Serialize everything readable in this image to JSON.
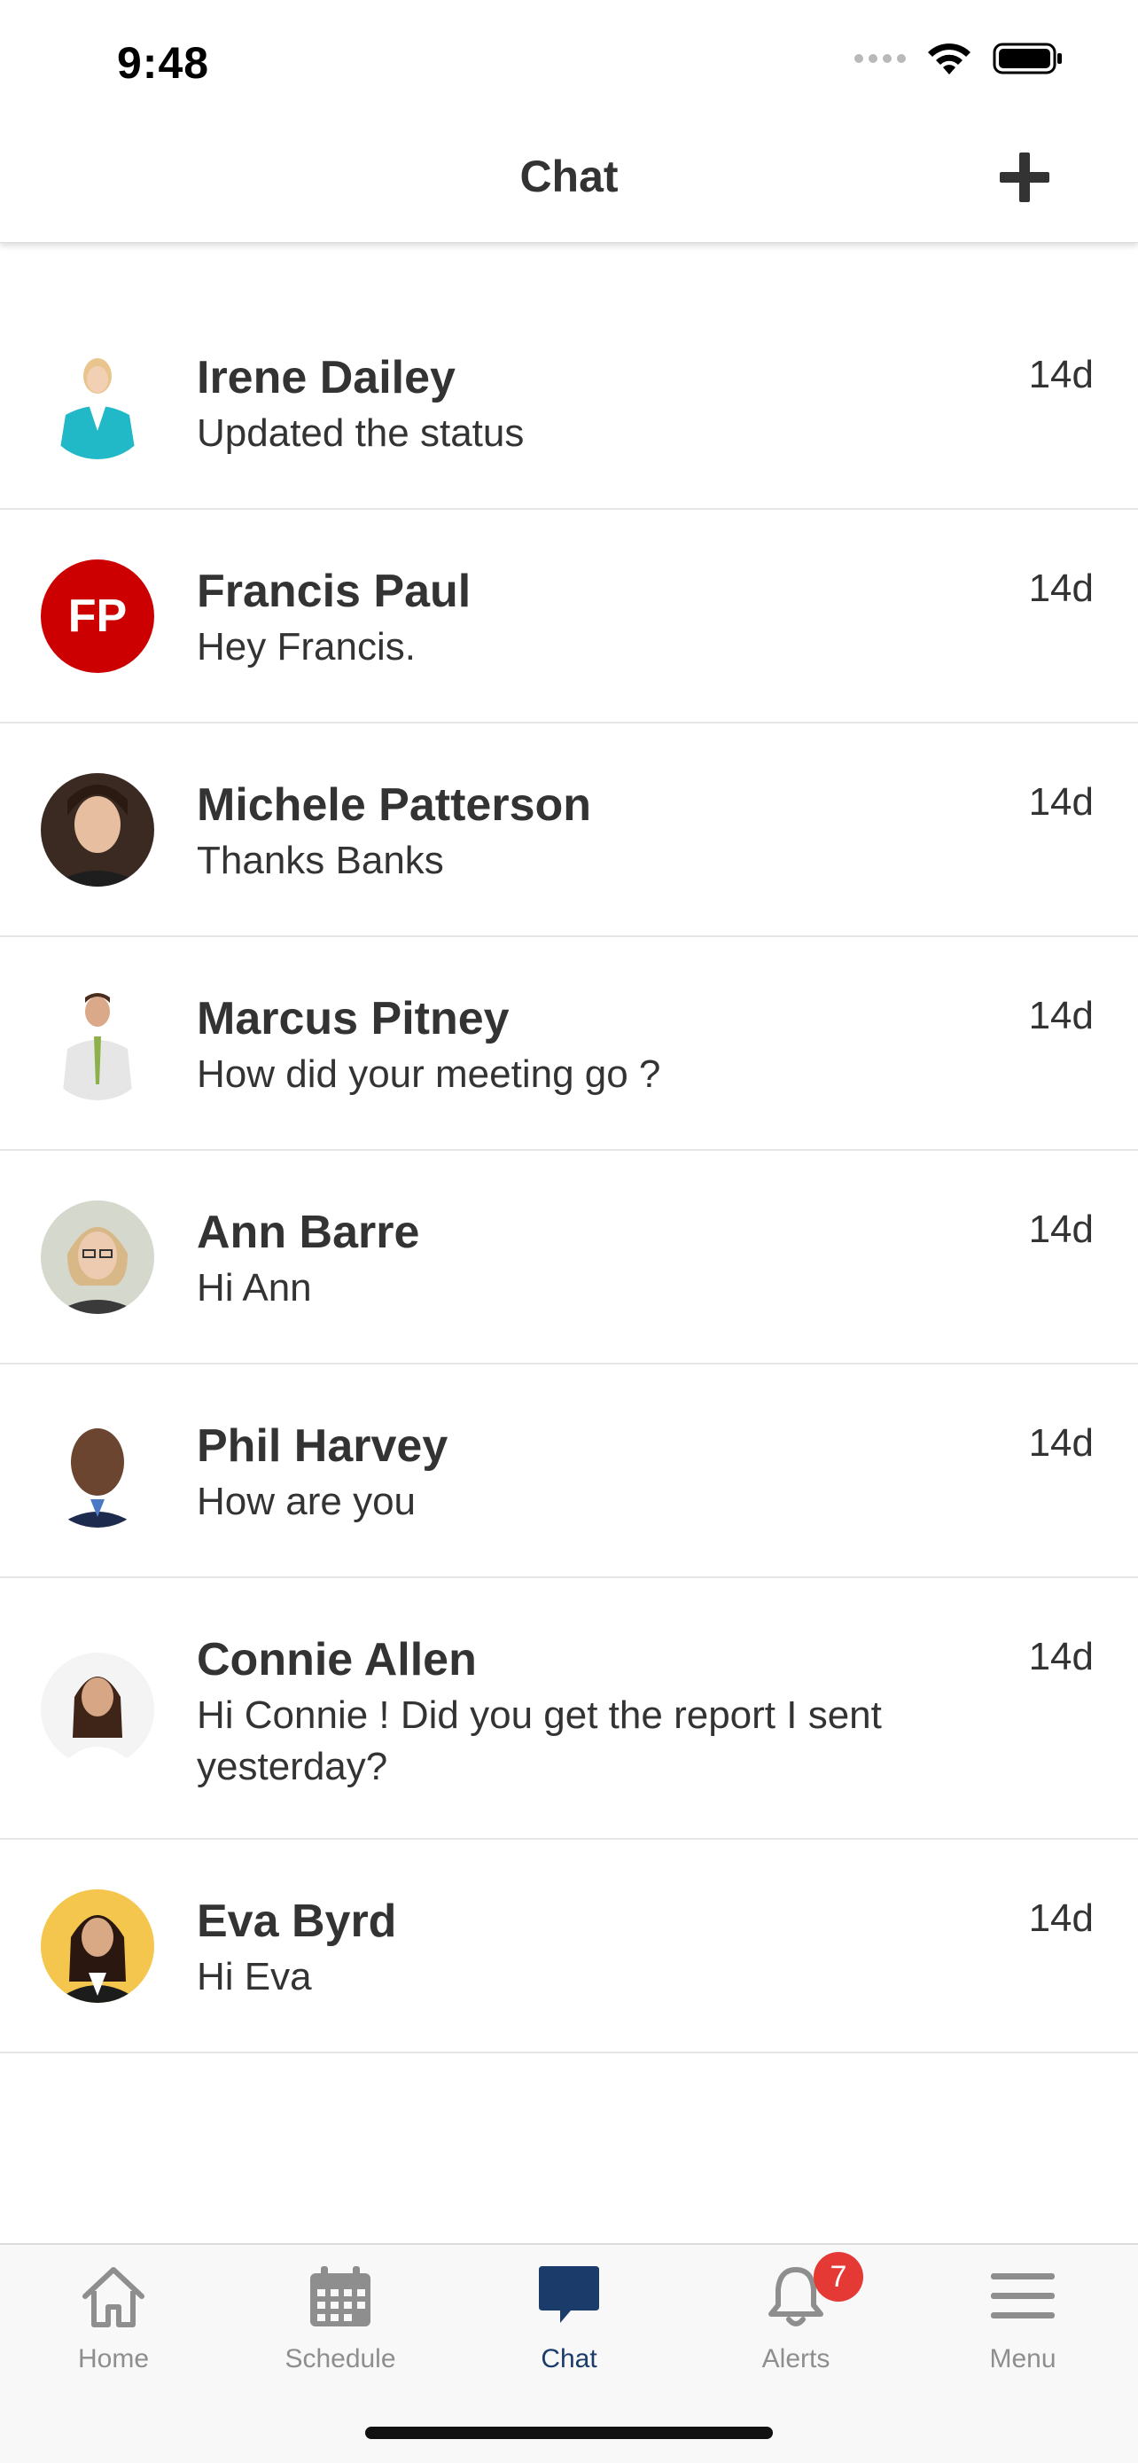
{
  "status_bar": {
    "time": "9:48"
  },
  "nav": {
    "title": "Chat"
  },
  "chats": [
    {
      "name": "Irene Dailey",
      "message": "Updated the status",
      "time": "14d",
      "avatar": "photo"
    },
    {
      "name": "Francis Paul",
      "message": "Hey Francis.",
      "time": "14d",
      "avatar": "initials",
      "initials": "FP",
      "avatar_color": "#cc0000"
    },
    {
      "name": "Michele Patterson",
      "message": "Thanks Banks",
      "time": "14d",
      "avatar": "photo"
    },
    {
      "name": "Marcus Pitney",
      "message": "How did your meeting go ?",
      "time": "14d",
      "avatar": "photo"
    },
    {
      "name": "Ann Barre",
      "message": "Hi Ann",
      "time": "14d",
      "avatar": "photo"
    },
    {
      "name": "Phil Harvey",
      "message": "How are you",
      "time": "14d",
      "avatar": "photo"
    },
    {
      "name": "Connie Allen",
      "message": "Hi Connie ! Did you get the report I sent yesterday?",
      "time": "14d",
      "avatar": "photo"
    },
    {
      "name": "Eva Byrd",
      "message": "Hi Eva",
      "time": "14d",
      "avatar": "photo"
    }
  ],
  "tabs": [
    {
      "label": "Home",
      "icon": "home-icon"
    },
    {
      "label": "Schedule",
      "icon": "calendar-icon"
    },
    {
      "label": "Chat",
      "icon": "chat-bubble-icon",
      "active": true
    },
    {
      "label": "Alerts",
      "icon": "bell-icon",
      "badge": "7"
    },
    {
      "label": "Menu",
      "icon": "hamburger-icon"
    }
  ],
  "colors": {
    "accent": "#1b3c6b",
    "badge": "#e53935",
    "text": "#333333",
    "inactive_tab": "#8e8e8e"
  }
}
